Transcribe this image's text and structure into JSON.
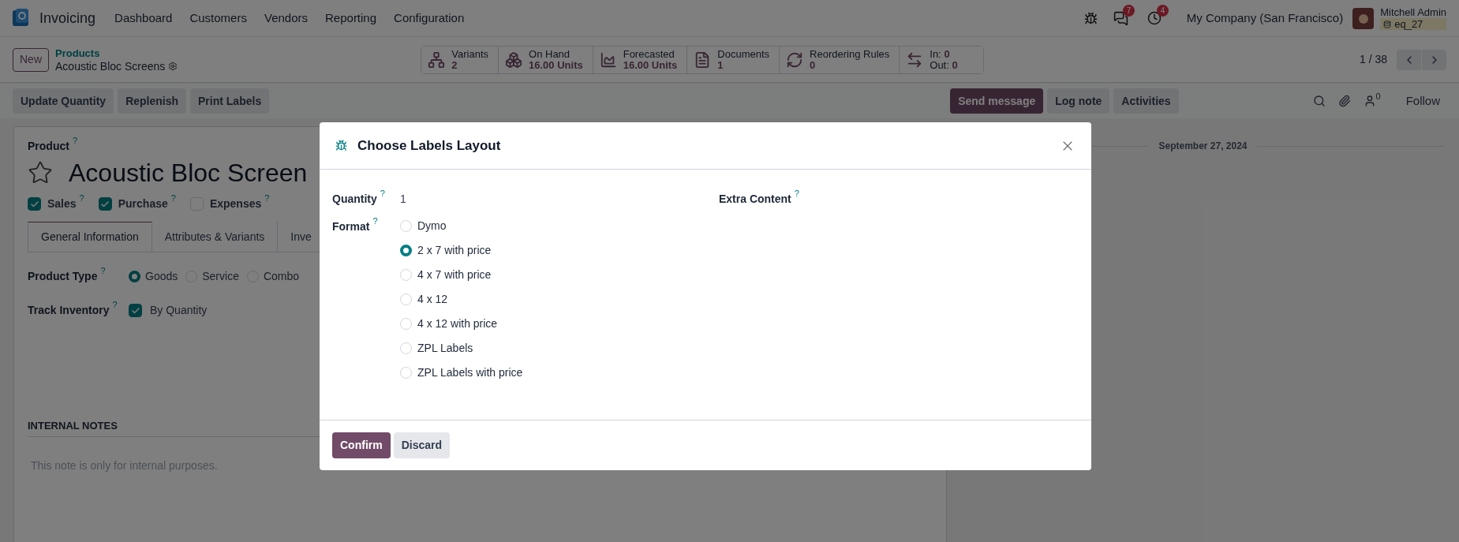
{
  "navbar": {
    "app_name": "Invoicing",
    "menu": [
      "Dashboard",
      "Customers",
      "Vendors",
      "Reporting",
      "Configuration"
    ],
    "messages_count": "7",
    "activities_count": "4",
    "company": "My Company (San Francisco)",
    "user_name": "Mitchell Admin",
    "database": "eq_27"
  },
  "control_panel": {
    "new_button": "New",
    "breadcrumb_parent": "Products",
    "record_name": "Acoustic Bloc Screens",
    "pager": "1 / 38",
    "stat_buttons": [
      {
        "kind": "variants",
        "title": "Variants",
        "value": "2"
      },
      {
        "kind": "on_hand",
        "title": "On Hand",
        "value": "16.00 Units"
      },
      {
        "kind": "forecasted",
        "title": "Forecasted",
        "value": "16.00 Units"
      },
      {
        "kind": "documents",
        "title": "Documents",
        "value": "1"
      },
      {
        "kind": "reordering",
        "title": "Reordering Rules",
        "value": "0"
      },
      {
        "kind": "in_out",
        "in_label": "In:",
        "in_value": "0",
        "out_label": "Out:",
        "out_value": "0"
      }
    ]
  },
  "action_buttons": [
    "Update Quantity",
    "Replenish",
    "Print Labels"
  ],
  "chatter": {
    "buttons": [
      {
        "label": "Send message",
        "kind": "primary"
      },
      {
        "label": "Log note",
        "kind": "secondary"
      },
      {
        "label": "Activities",
        "kind": "secondary"
      }
    ],
    "followers_count": "0",
    "follow": "Follow",
    "date": "September 27, 2024"
  },
  "form": {
    "product_label": "Product",
    "help": "?",
    "starred": false,
    "product_name": "Acoustic Bloc Screen",
    "flags": [
      {
        "label": "Sales",
        "checked": true
      },
      {
        "label": "Purchase",
        "checked": true
      },
      {
        "label": "Expenses",
        "checked": false
      }
    ],
    "tabs": [
      {
        "label": "General Information",
        "selected": true
      },
      {
        "label": "Attributes & Variants",
        "selected": false
      },
      {
        "label": "Inve",
        "selected": false
      }
    ],
    "product_type": {
      "label": "Product Type",
      "options": [
        {
          "label": "Goods",
          "selected": true
        },
        {
          "label": "Service",
          "selected": false
        },
        {
          "label": "Combo",
          "selected": false
        }
      ]
    },
    "track_inventory": {
      "label": "Track Inventory",
      "checked": true,
      "option": "By Quantity"
    },
    "internal_notes": {
      "heading": "INTERNAL NOTES",
      "placeholder": "This note is only for internal purposes."
    }
  },
  "dialog": {
    "title": "Choose Labels Layout",
    "quantity_label": "Quantity",
    "quantity_value": "1",
    "extra_content_label": "Extra Content",
    "format_label": "Format",
    "formats": [
      {
        "label": "Dymo",
        "selected": false
      },
      {
        "label": "2 x 7 with price",
        "selected": true
      },
      {
        "label": "4 x 7 with price",
        "selected": false
      },
      {
        "label": "4 x 12",
        "selected": false
      },
      {
        "label": "4 x 12 with price",
        "selected": false
      },
      {
        "label": "ZPL Labels",
        "selected": false
      },
      {
        "label": "ZPL Labels with price",
        "selected": false
      }
    ],
    "confirm": "Confirm",
    "discard": "Discard"
  }
}
